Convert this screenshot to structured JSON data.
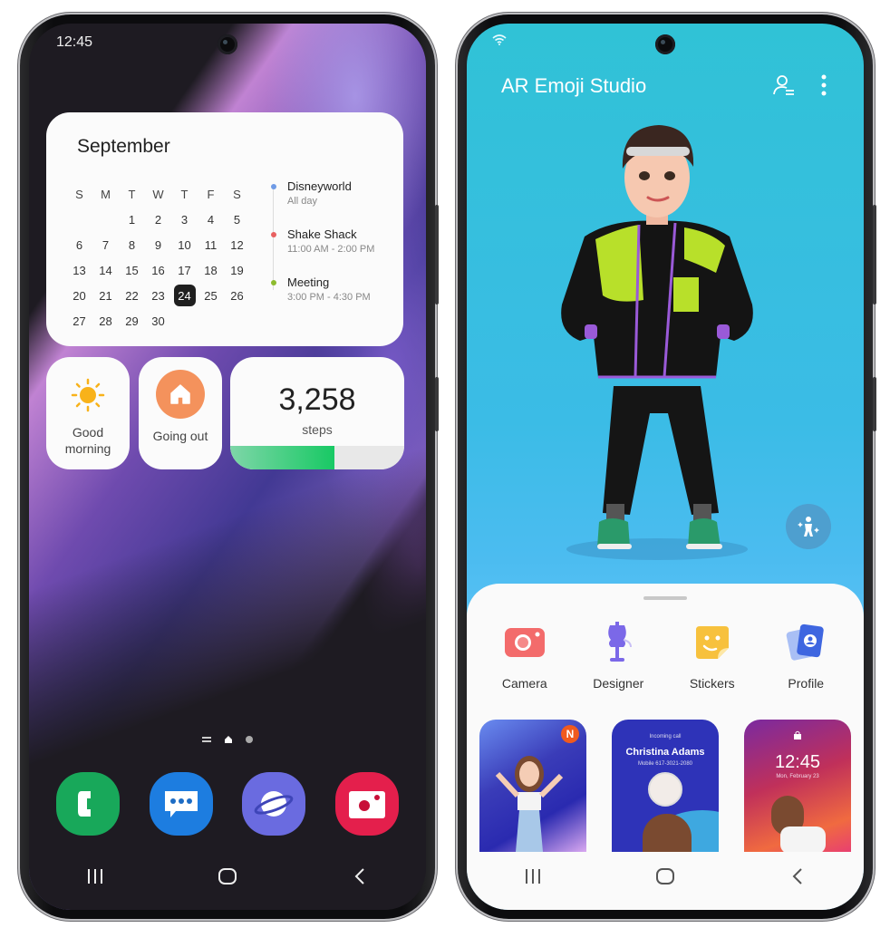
{
  "left_phone": {
    "status_bar": {
      "time": "12:45"
    },
    "calendar_widget": {
      "month": "September",
      "weekdays": [
        "S",
        "M",
        "T",
        "W",
        "T",
        "F",
        "S"
      ],
      "weeks": [
        [
          "",
          "",
          "1",
          "2",
          "3",
          "4",
          "5"
        ],
        [
          "6",
          "7",
          "8",
          "9",
          "10",
          "11",
          "12"
        ],
        [
          "13",
          "14",
          "15",
          "16",
          "17",
          "18",
          "19"
        ],
        [
          "20",
          "21",
          "22",
          "23",
          "24",
          "25",
          "26"
        ],
        [
          "27",
          "28",
          "29",
          "30",
          "",
          "",
          ""
        ]
      ],
      "today": "24",
      "events": [
        {
          "title": "Disneyworld",
          "time": "All day",
          "color": "#6f9be6"
        },
        {
          "title": "Shake Shack",
          "time": "11:00 AM - 2:00 PM",
          "color": "#e86060"
        },
        {
          "title": "Meeting",
          "time": "3:00 PM - 4:30 PM",
          "color": "#8dbb2e"
        }
      ]
    },
    "weather_widget": {
      "label_line1": "Good",
      "label_line2": "morning",
      "icon": "sun-icon"
    },
    "routine_widget": {
      "label": "Going out",
      "icon": "home-icon",
      "color": "#f4925c"
    },
    "steps_widget": {
      "count": "3,258",
      "unit": "steps",
      "progress_percent": 60
    },
    "page_indicator": {
      "pages": 2,
      "current": 1
    },
    "dock": [
      {
        "name": "Phone",
        "icon": "phone-icon",
        "color": "#18a85a"
      },
      {
        "name": "Messages",
        "icon": "messages-icon",
        "color": "#1d7de0"
      },
      {
        "name": "Internet",
        "icon": "internet-icon",
        "color": "#6a6be0"
      },
      {
        "name": "Camera",
        "icon": "camera-icon",
        "color": "#e41f4c"
      }
    ],
    "navbar": [
      "recents",
      "home",
      "back"
    ]
  },
  "right_phone": {
    "app_title": "AR Emoji Studio",
    "header_icons": [
      "profile-manage-icon",
      "more-options-icon"
    ],
    "motion_button": "motion-icon",
    "menu": [
      {
        "label": "Camera",
        "icon": "camera-icon",
        "color": "#f36b6b"
      },
      {
        "label": "Designer",
        "icon": "mannequin-icon",
        "color": "#7b68e8"
      },
      {
        "label": "Stickers",
        "icon": "sticker-icon",
        "color": "#f7c13d"
      },
      {
        "label": "Profile",
        "icon": "profile-card-icon",
        "color": "#3e66e0"
      }
    ],
    "thumbnails": [
      {
        "badge": "N"
      },
      {
        "caption": "Incoming call",
        "name": "Christina Adams",
        "number": "Mobile 617-3021-2080"
      },
      {
        "time": "12:45",
        "date": "Mon, February 23"
      }
    ],
    "navbar": [
      "recents",
      "home",
      "back"
    ]
  }
}
